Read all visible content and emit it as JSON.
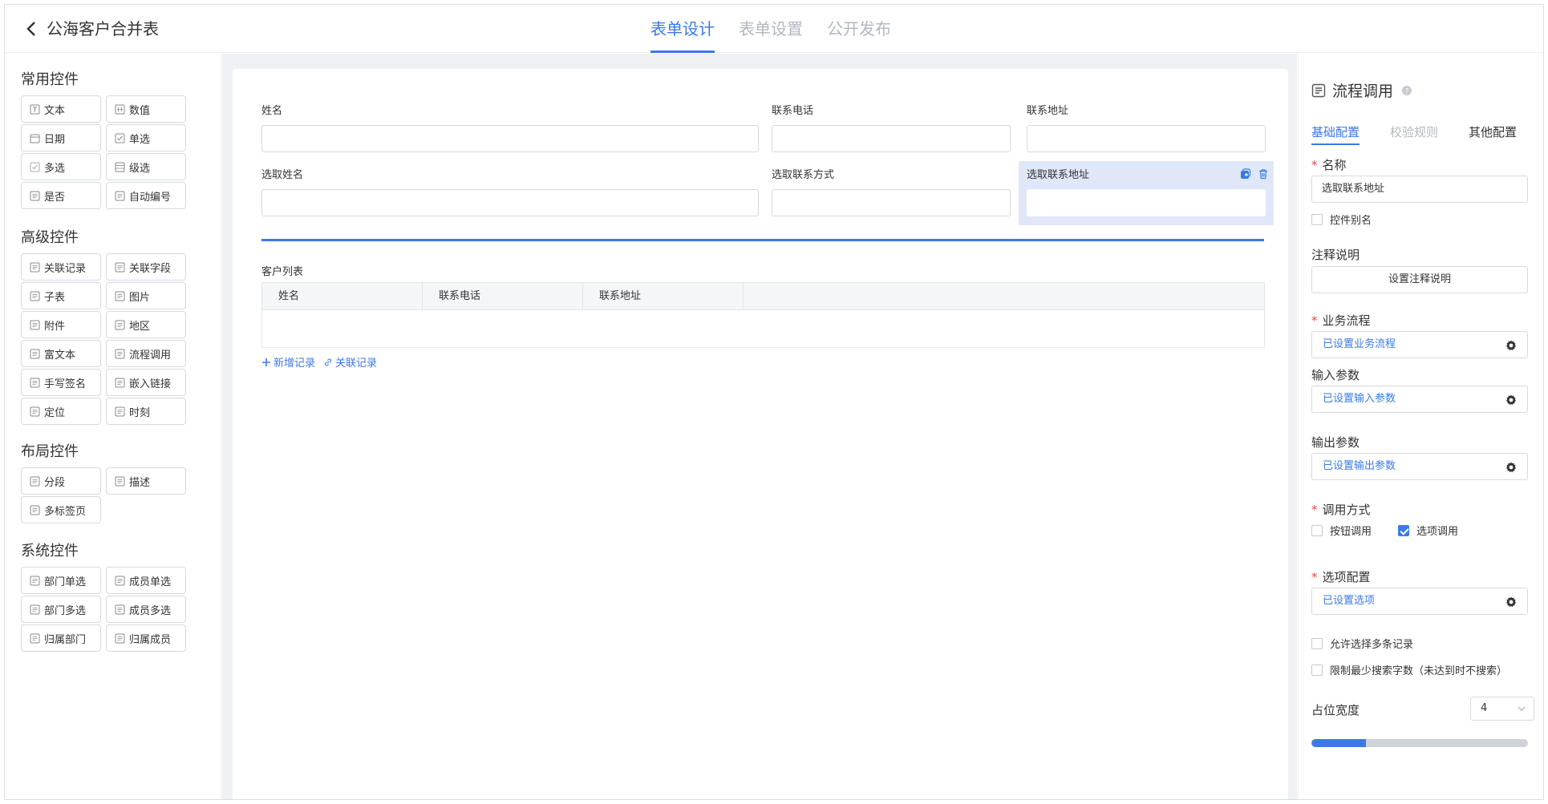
{
  "header": {
    "title": "公海客户合并表",
    "tabs": [
      "表单设计",
      "表单设置",
      "公开发布"
    ]
  },
  "palette": {
    "groups": [
      {
        "title": "常用控件",
        "items": [
          {
            "label": "文本",
            "icon": "text-icon"
          },
          {
            "label": "数值",
            "icon": "number-icon"
          },
          {
            "label": "日期",
            "icon": "calendar-icon"
          },
          {
            "label": "单选",
            "icon": "radio-icon"
          },
          {
            "label": "多选",
            "icon": "checkbox-icon"
          },
          {
            "label": "级选",
            "icon": "cascade-icon"
          },
          {
            "label": "是否",
            "icon": "toggle-icon"
          },
          {
            "label": "自动编号",
            "icon": "auto-number-icon"
          }
        ]
      },
      {
        "title": "高级控件",
        "items": [
          {
            "label": "关联记录",
            "icon": "link-record-icon"
          },
          {
            "label": "关联字段",
            "icon": "link-field-icon"
          },
          {
            "label": "子表",
            "icon": "subtable-icon"
          },
          {
            "label": "图片",
            "icon": "image-icon"
          },
          {
            "label": "附件",
            "icon": "attachment-icon"
          },
          {
            "label": "地区",
            "icon": "region-icon"
          },
          {
            "label": "富文本",
            "icon": "rich-text-icon"
          },
          {
            "label": "流程调用",
            "icon": "process-icon"
          },
          {
            "label": "手写签名",
            "icon": "signature-icon"
          },
          {
            "label": "嵌入链接",
            "icon": "embed-link-icon"
          },
          {
            "label": "定位",
            "icon": "location-icon"
          },
          {
            "label": "时刻",
            "icon": "clock-icon"
          }
        ]
      },
      {
        "title": "布局控件",
        "items": [
          {
            "label": "分段",
            "icon": "section-icon"
          },
          {
            "label": "描述",
            "icon": "description-icon"
          },
          {
            "label": "多标签页",
            "icon": "tabs-icon"
          }
        ]
      },
      {
        "title": "系统控件",
        "items": [
          {
            "label": "部门单选",
            "icon": "department-icon"
          },
          {
            "label": "成员单选",
            "icon": "member-icon"
          },
          {
            "label": "部门多选",
            "icon": "department-icon"
          },
          {
            "label": "成员多选",
            "icon": "member-icon"
          },
          {
            "label": "归属部门",
            "icon": "owner-department-icon"
          },
          {
            "label": "归属成员",
            "icon": "owner-member-icon"
          }
        ]
      }
    ]
  },
  "form": {
    "fields": [
      {
        "label": "姓名"
      },
      {
        "label": "联系电话"
      },
      {
        "label": "联系地址"
      },
      {
        "label": "选取姓名"
      },
      {
        "label": "选取联系方式"
      },
      {
        "label": "选取联系地址"
      }
    ],
    "subtable": {
      "title": "客户列表",
      "columns": [
        "姓名",
        "联系电话",
        "联系地址"
      ],
      "add_label": "新增记录",
      "link_label": "关联记录"
    }
  },
  "config": {
    "title": "流程调用",
    "tabs": [
      "基础配置",
      "校验规则",
      "其他配置"
    ],
    "name_label": "名称",
    "name_value": "选取联系地址",
    "alias_label": "控件别名",
    "note_label": "注释说明",
    "note_button": "设置注释说明",
    "flow_label": "业务流程",
    "flow_value": "已设置业务流程",
    "input_label": "输入参数",
    "input_value": "已设置输入参数",
    "output_label": "输出参数",
    "output_value": "已设置输出参数",
    "call_label": "调用方式",
    "call_button": "按钮调用",
    "call_option": "选项调用",
    "option_label": "选项配置",
    "option_value": "已设置选项",
    "allow_multi": "允许选择多条记录",
    "limit_search": "限制最少搜索字数（未达到时不搜索）",
    "width_label": "占位宽度",
    "width_value": "4",
    "width_fraction": 0.25,
    "accent_color": "#3b7ae6"
  }
}
